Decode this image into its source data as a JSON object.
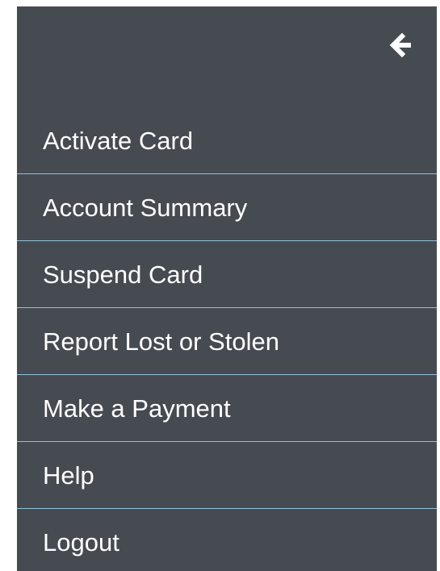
{
  "back": {
    "icon": "arrow-left-icon",
    "icon_color": "#ffffff"
  },
  "menu": {
    "items": [
      {
        "label": "Activate Card"
      },
      {
        "label": "Account Summary"
      },
      {
        "label": "Suspend Card"
      },
      {
        "label": "Report Lost or Stolen"
      },
      {
        "label": "Make a Payment"
      },
      {
        "label": "Help"
      },
      {
        "label": "Logout"
      }
    ]
  },
  "colors": {
    "panel_background": "#464a51",
    "divider": "#8ec3db",
    "text": "#ffffff"
  }
}
